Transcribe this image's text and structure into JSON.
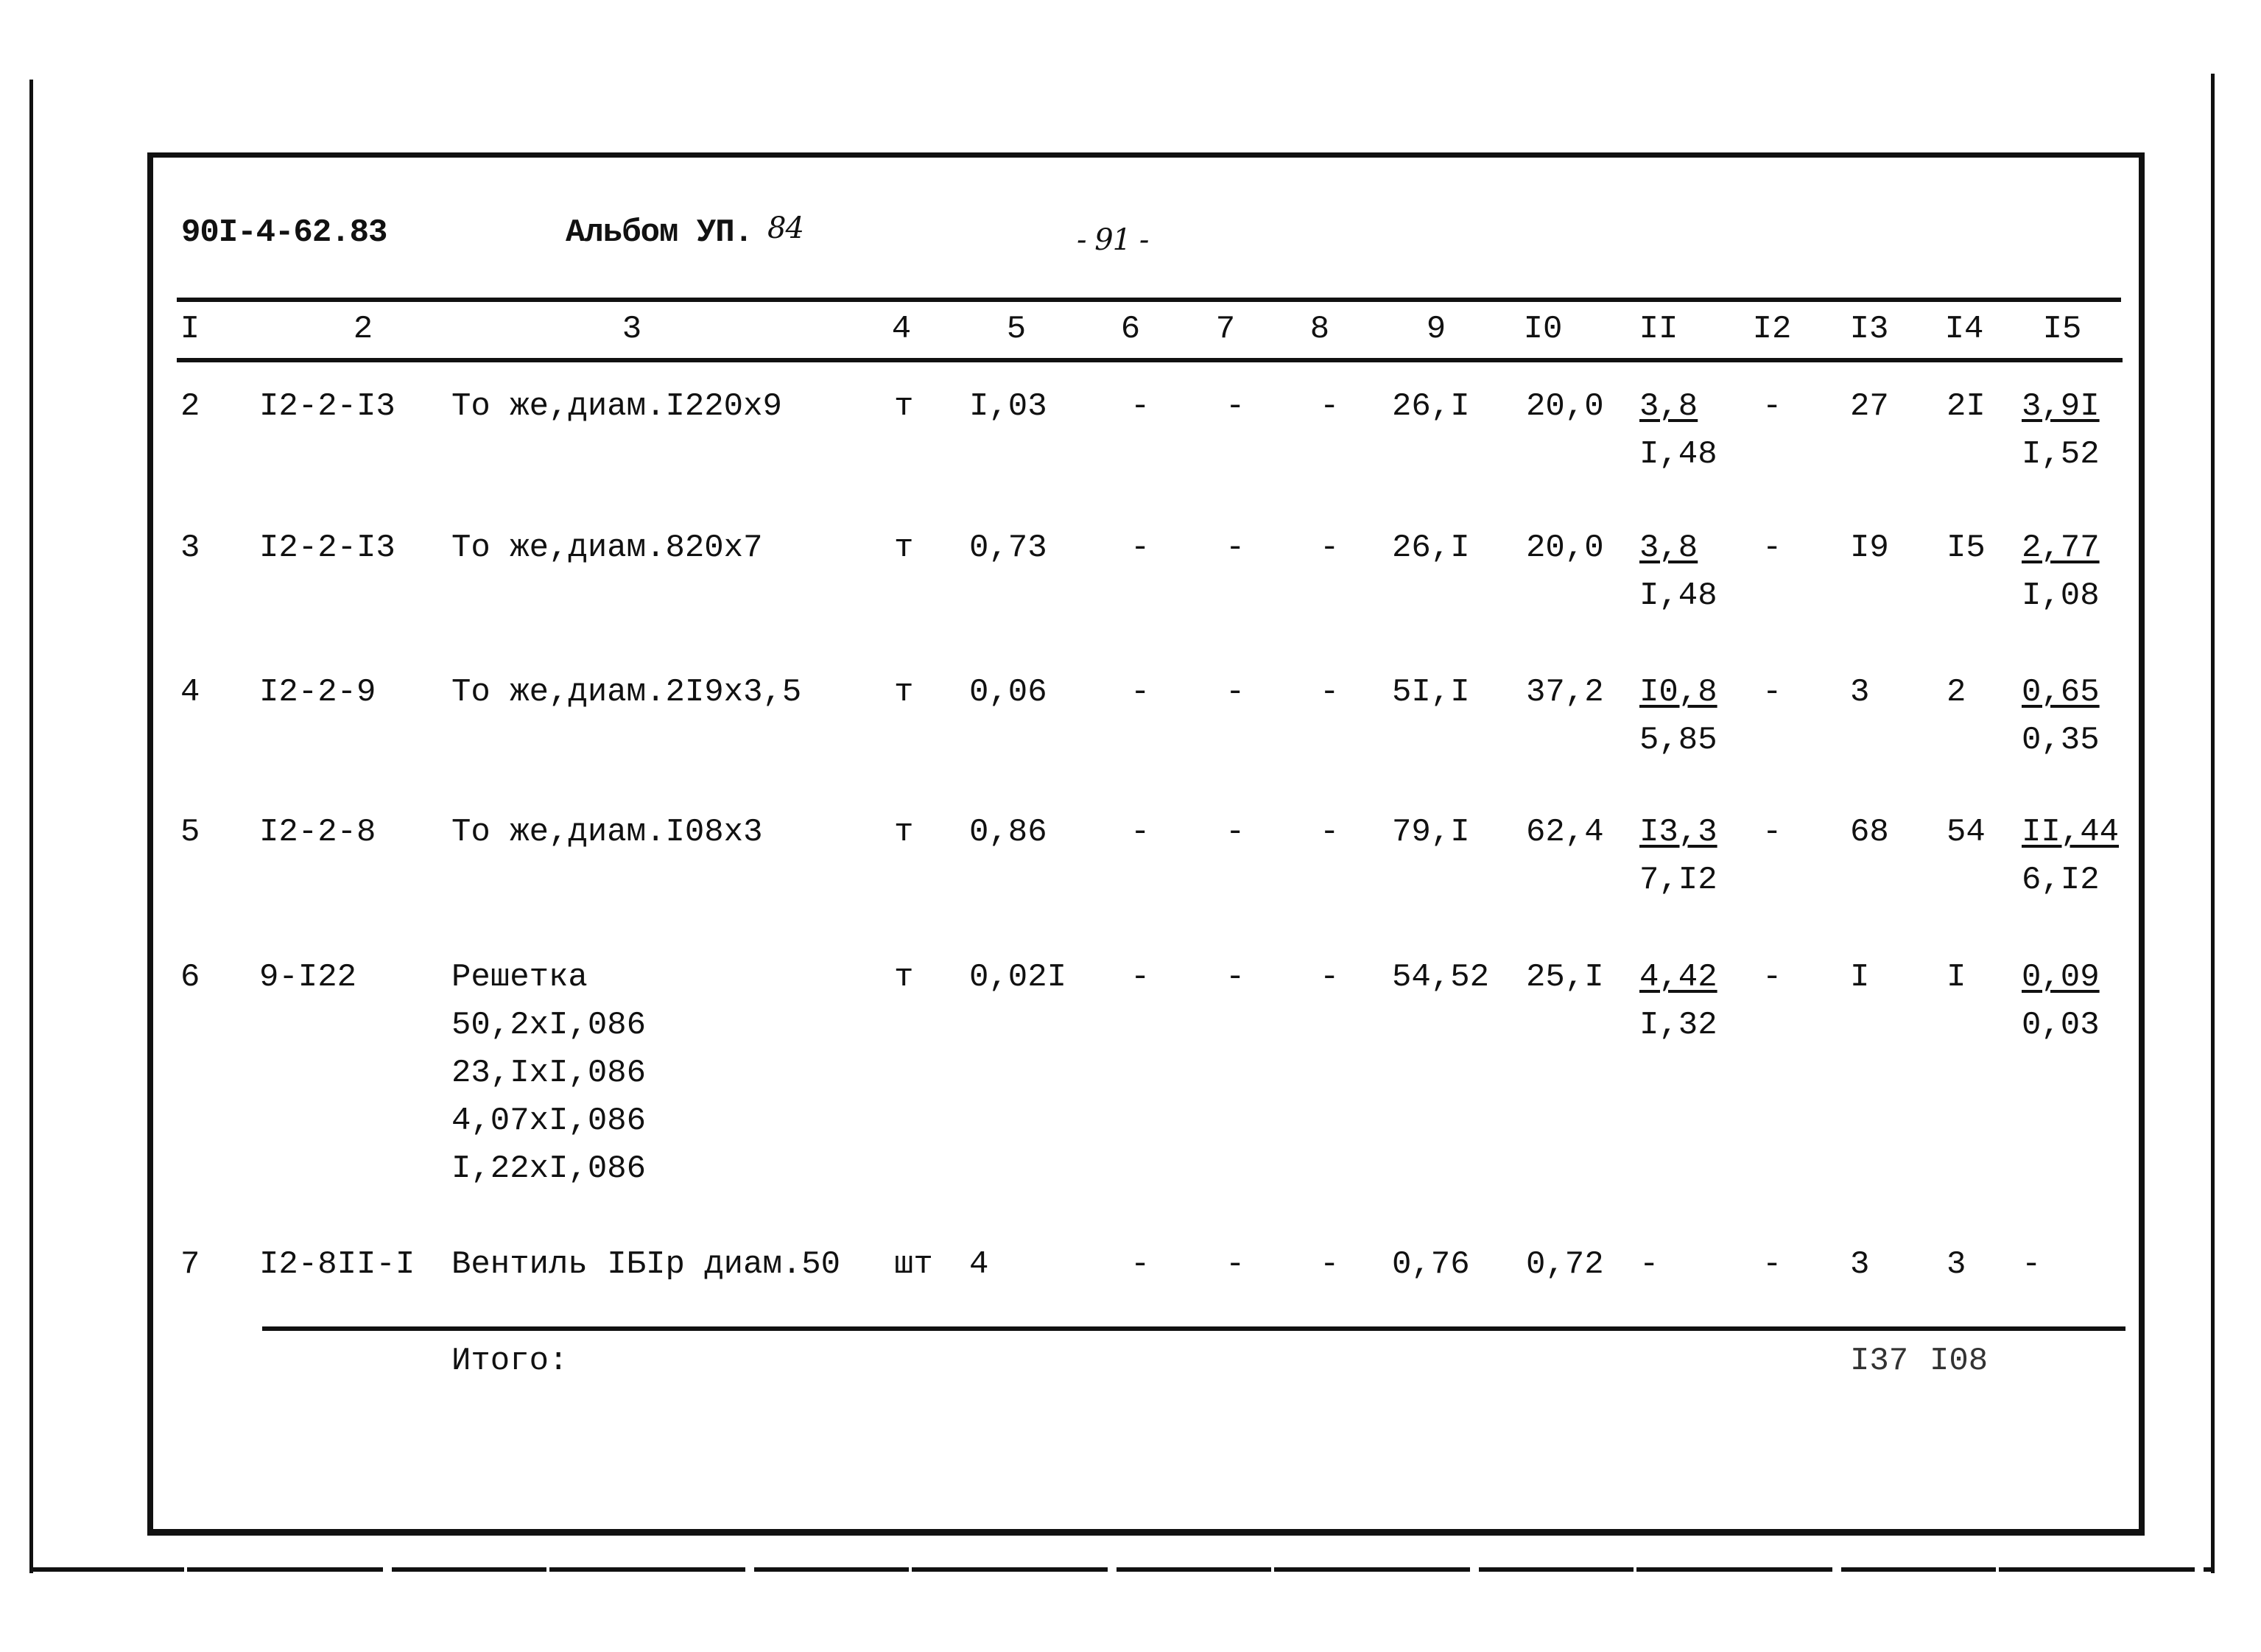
{
  "header": {
    "doc_code": "90I-4-62.83",
    "album_label": "Альбом УП.",
    "album_number": "84",
    "page_number": "- 91 -"
  },
  "table": {
    "columns": [
      "I",
      "2",
      "3",
      "4",
      "5",
      "6",
      "7",
      "8",
      "9",
      "I0",
      "II",
      "I2",
      "I3",
      "I4",
      "I5"
    ],
    "rows": [
      {
        "c1": "2",
        "c2": "I2-2-I3",
        "c3": [
          "То же,диам.I220x9"
        ],
        "c4": "т",
        "c5": "I,03",
        "c6": "-",
        "c7": "-",
        "c8": "-",
        "c9": "26,I",
        "c10": "20,0",
        "c11": {
          "top": "3,8",
          "bottom": "I,48"
        },
        "c12": "-",
        "c13": "27",
        "c14": "2I",
        "c15": {
          "top": "3,9I",
          "bottom": "I,52"
        }
      },
      {
        "c1": "3",
        "c2": "I2-2-I3",
        "c3": [
          "То же,диам.820x7"
        ],
        "c4": "т",
        "c5": "0,73",
        "c6": "-",
        "c7": "-",
        "c8": "-",
        "c9": "26,I",
        "c10": "20,0",
        "c11": {
          "top": "3,8",
          "bottom": "I,48"
        },
        "c12": "-",
        "c13": "I9",
        "c14": "I5",
        "c15": {
          "top": "2,77",
          "bottom": "I,08"
        }
      },
      {
        "c1": "4",
        "c2": "I2-2-9",
        "c3": [
          "То же,диам.2I9x3,5"
        ],
        "c4": "т",
        "c5": "0,06",
        "c6": "-",
        "c7": "-",
        "c8": "-",
        "c9": "5I,I",
        "c10": "37,2",
        "c11": {
          "top": "I0,8",
          "bottom": "5,85"
        },
        "c12": "-",
        "c13": "3",
        "c14": "2",
        "c15": {
          "top": "0,65",
          "bottom": "0,35"
        }
      },
      {
        "c1": "5",
        "c2": "I2-2-8",
        "c3": [
          "То же,диам.I08x3"
        ],
        "c4": "т",
        "c5": "0,86",
        "c6": "-",
        "c7": "-",
        "c8": "-",
        "c9": "79,I",
        "c10": "62,4",
        "c11": {
          "top": "I3,3",
          "bottom": "7,I2"
        },
        "c12": "-",
        "c13": "68",
        "c14": "54",
        "c15": {
          "top": "II,44",
          "bottom": "6,I2"
        }
      },
      {
        "c1": "6",
        "c2": "9-I22",
        "c3": [
          "Решетка",
          "50,2xI,086",
          "23,IxI,086",
          "4,07xI,086",
          "I,22xI,086"
        ],
        "c4": "т",
        "c5": "0,02I",
        "c6": "-",
        "c7": "-",
        "c8": "-",
        "c9": "54,52",
        "c10": "25,I",
        "c11": {
          "top": "4,42",
          "bottom": "I,32"
        },
        "c12": "-",
        "c13": "I",
        "c14": "I",
        "c15": {
          "top": "0,09",
          "bottom": "0,03"
        }
      },
      {
        "c1": "7",
        "c2": "I2-8II-I",
        "c3": [
          "Вентиль IБIр диам.50"
        ],
        "c4": "шт",
        "c5": "4",
        "c6": "-",
        "c7": "-",
        "c8": "-",
        "c9": "0,76",
        "c10": "0,72",
        "c11": "-",
        "c12": "-",
        "c13": "3",
        "c14": "3",
        "c15": "-"
      }
    ],
    "total": {
      "label": "Итого:",
      "c13": "I37",
      "c14": "I08"
    }
  }
}
